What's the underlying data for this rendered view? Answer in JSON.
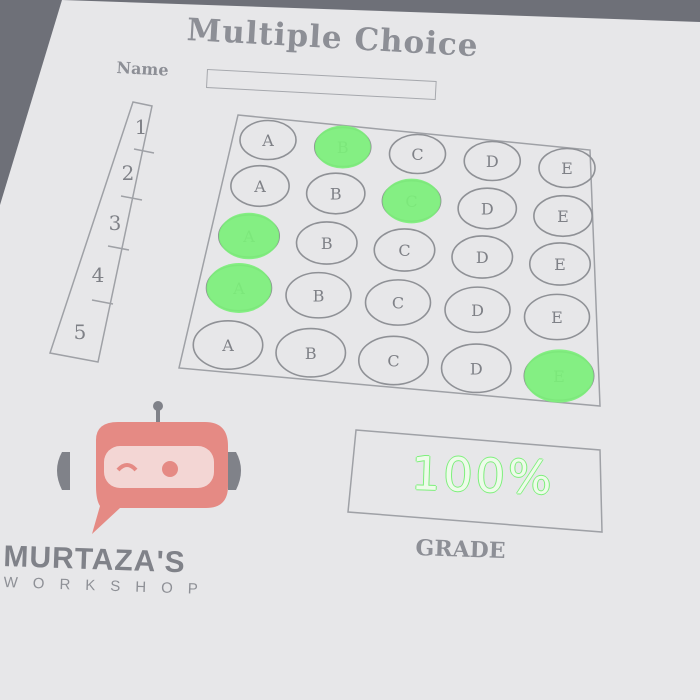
{
  "sheet": {
    "title": "Multiple Choice",
    "name_label": "Name",
    "name_value": ""
  },
  "questions": [
    {
      "number": "1",
      "options": [
        "A",
        "B",
        "C",
        "D",
        "E"
      ],
      "selected": "B"
    },
    {
      "number": "2",
      "options": [
        "A",
        "B",
        "C",
        "D",
        "E"
      ],
      "selected": "C"
    },
    {
      "number": "3",
      "options": [
        "A",
        "B",
        "C",
        "D",
        "E"
      ],
      "selected": "A"
    },
    {
      "number": "4",
      "options": [
        "A",
        "B",
        "C",
        "D",
        "E"
      ],
      "selected": "A"
    },
    {
      "number": "5",
      "options": [
        "A",
        "B",
        "C",
        "D",
        "E"
      ],
      "selected": "E"
    }
  ],
  "grade": {
    "label": "GRADE",
    "value": "100%"
  },
  "logo": {
    "line1": "MURTAZA'S",
    "line2": "WORKSHOP",
    "icon": "robot-icon"
  },
  "colors": {
    "background": "#6e7078",
    "paper": "#e8e8ea",
    "ink": "#8a8c92",
    "correct_mark": "#7cf07a",
    "logo_red": "#e58a84"
  }
}
